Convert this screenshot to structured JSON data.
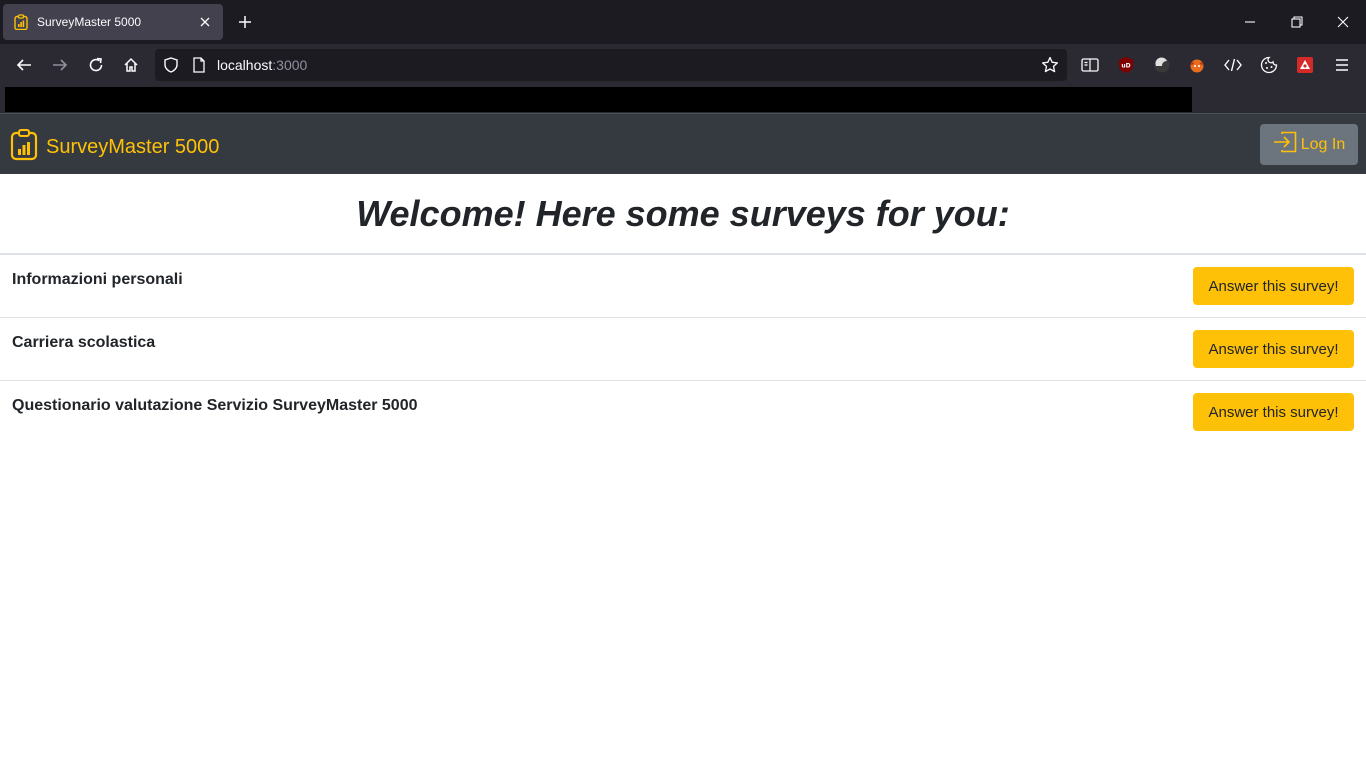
{
  "browser": {
    "tab_title": "SurveyMaster 5000",
    "url_host": "localhost",
    "url_port": ":3000"
  },
  "app": {
    "brand": "SurveyMaster 5000",
    "login_label": "Log In",
    "welcome": "Welcome! Here some surveys for you:",
    "accent_color": "#ffc107",
    "surveys": [
      {
        "title": "Informazioni personali",
        "button": "Answer this survey!"
      },
      {
        "title": "Carriera scolastica",
        "button": "Answer this survey!"
      },
      {
        "title": "Questionario valutazione Servizio SurveyMaster 5000",
        "button": "Answer this survey!"
      }
    ]
  },
  "icons": {
    "favicon": "clipboard-chart-icon",
    "login": "box-arrow-in-icon"
  }
}
